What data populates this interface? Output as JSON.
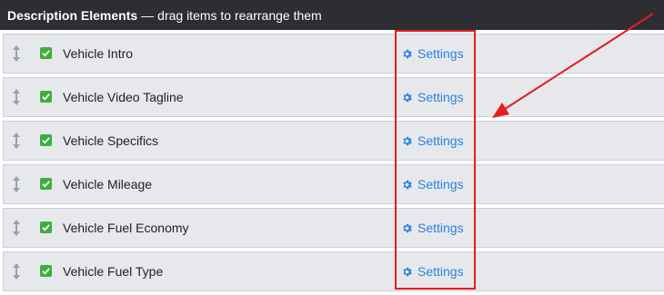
{
  "header": {
    "title": "Description Elements",
    "separator": "—",
    "subtitle": "drag items to rearrange them"
  },
  "items": [
    {
      "label": "Vehicle Intro",
      "checked": true,
      "settings_label": "Settings"
    },
    {
      "label": "Vehicle Video Tagline",
      "checked": true,
      "settings_label": "Settings"
    },
    {
      "label": "Vehicle Specifics",
      "checked": true,
      "settings_label": "Settings"
    },
    {
      "label": "Vehicle Mileage",
      "checked": true,
      "settings_label": "Settings"
    },
    {
      "label": "Vehicle Fuel Economy",
      "checked": true,
      "settings_label": "Settings"
    },
    {
      "label": "Vehicle Fuel Type",
      "checked": true,
      "settings_label": "Settings"
    }
  ],
  "colors": {
    "header_bg": "#2c2e32",
    "row_bg": "#e6e8eb",
    "checkbox": "#3fae3f",
    "link": "#2b82e0",
    "annotation": "#e41e1e"
  },
  "icons": {
    "drag": "vertical-drag-handle-icon",
    "checkbox": "checkmark-icon",
    "settings": "gear-icon"
  }
}
